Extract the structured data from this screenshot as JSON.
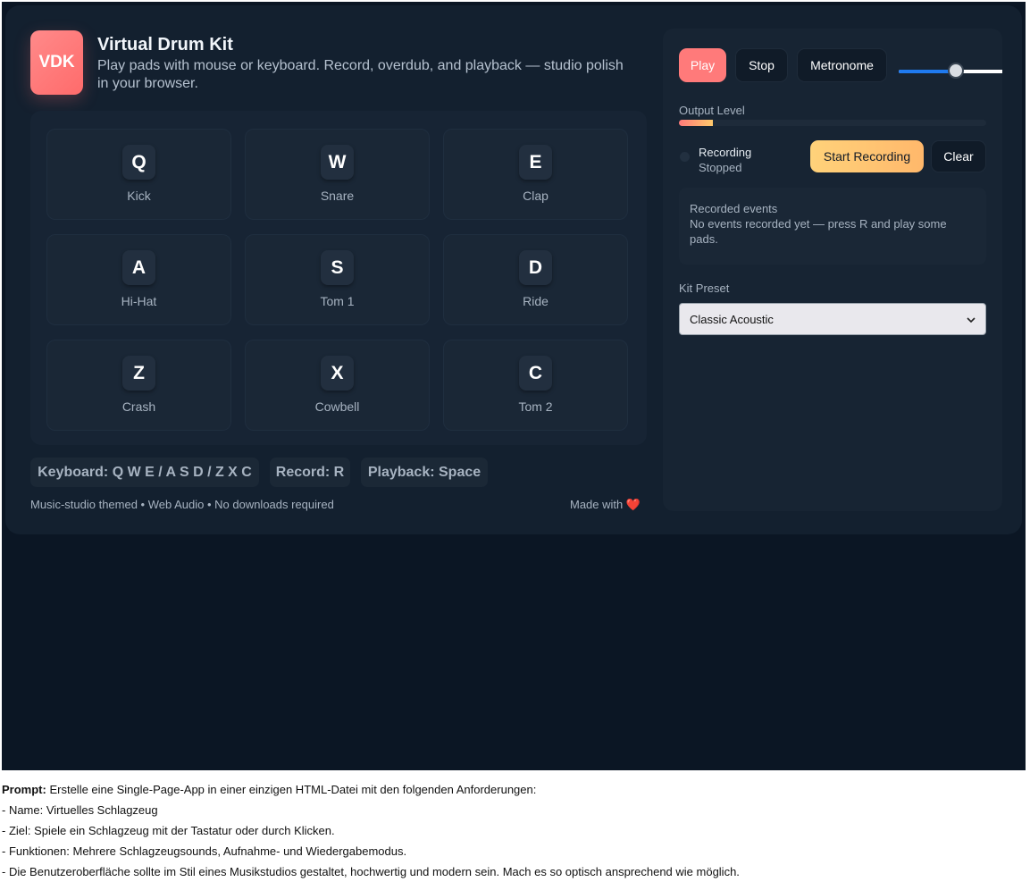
{
  "header": {
    "logo_text": "VDK",
    "title": "Virtual Drum Kit",
    "subtitle": "Play pads with mouse or keyboard. Record, overdub, and playback — studio polish in your browser."
  },
  "pads": [
    {
      "key": "Q",
      "name": "Kick"
    },
    {
      "key": "W",
      "name": "Snare"
    },
    {
      "key": "E",
      "name": "Clap"
    },
    {
      "key": "A",
      "name": "Hi-Hat"
    },
    {
      "key": "S",
      "name": "Tom 1"
    },
    {
      "key": "D",
      "name": "Ride"
    },
    {
      "key": "Z",
      "name": "Crash"
    },
    {
      "key": "X",
      "name": "Cowbell"
    },
    {
      "key": "C",
      "name": "Tom 2"
    }
  ],
  "shortcuts": {
    "keyboard": "Keyboard: Q W E / A S D / Z X C",
    "record": "Record: R",
    "playback": "Playback: Space"
  },
  "footer": {
    "left": "Music-studio themed • Web Audio • No downloads required",
    "right": "Made with ❤️"
  },
  "transport": {
    "play_label": "Play",
    "stop_label": "Stop",
    "metronome_label": "Metronome",
    "tempo_slider_fraction": 0.48
  },
  "output": {
    "label": "Output Level",
    "level_fraction": 0.11
  },
  "recording": {
    "title": "Recording",
    "status": "Stopped",
    "start_label": "Start Recording",
    "clear_label": "Clear"
  },
  "events": {
    "title": "Recorded events",
    "empty_text": "No events recorded yet — press R and play some pads."
  },
  "kit": {
    "label": "Kit Preset",
    "selected": "Classic Acoustic"
  },
  "caption": {
    "prompt_label": "Prompt:",
    "prompt_text": "Erstelle eine Single-Page-App in einer einzigen HTML-Datei mit den folgenden Anforderungen:",
    "lines": [
      "- Name: Virtuelles Schlagzeug",
      "- Ziel: Spiele ein Schlagzeug mit der Tastatur oder durch Klicken.",
      "- Funktionen: Mehrere Schlagzeugsounds, Aufnahme- und Wiedergabemodus.",
      "- Die Benutzeroberfläche sollte im Stil eines Musikstudios gestaltet, hochwertig und modern sein. Mach es so optisch ansprechend wie möglich."
    ]
  },
  "colors": {
    "accent": "#ff7a7a",
    "record_button": "#ffc96b",
    "slider_fill": "#1f7af0",
    "background": "#0b1624"
  }
}
